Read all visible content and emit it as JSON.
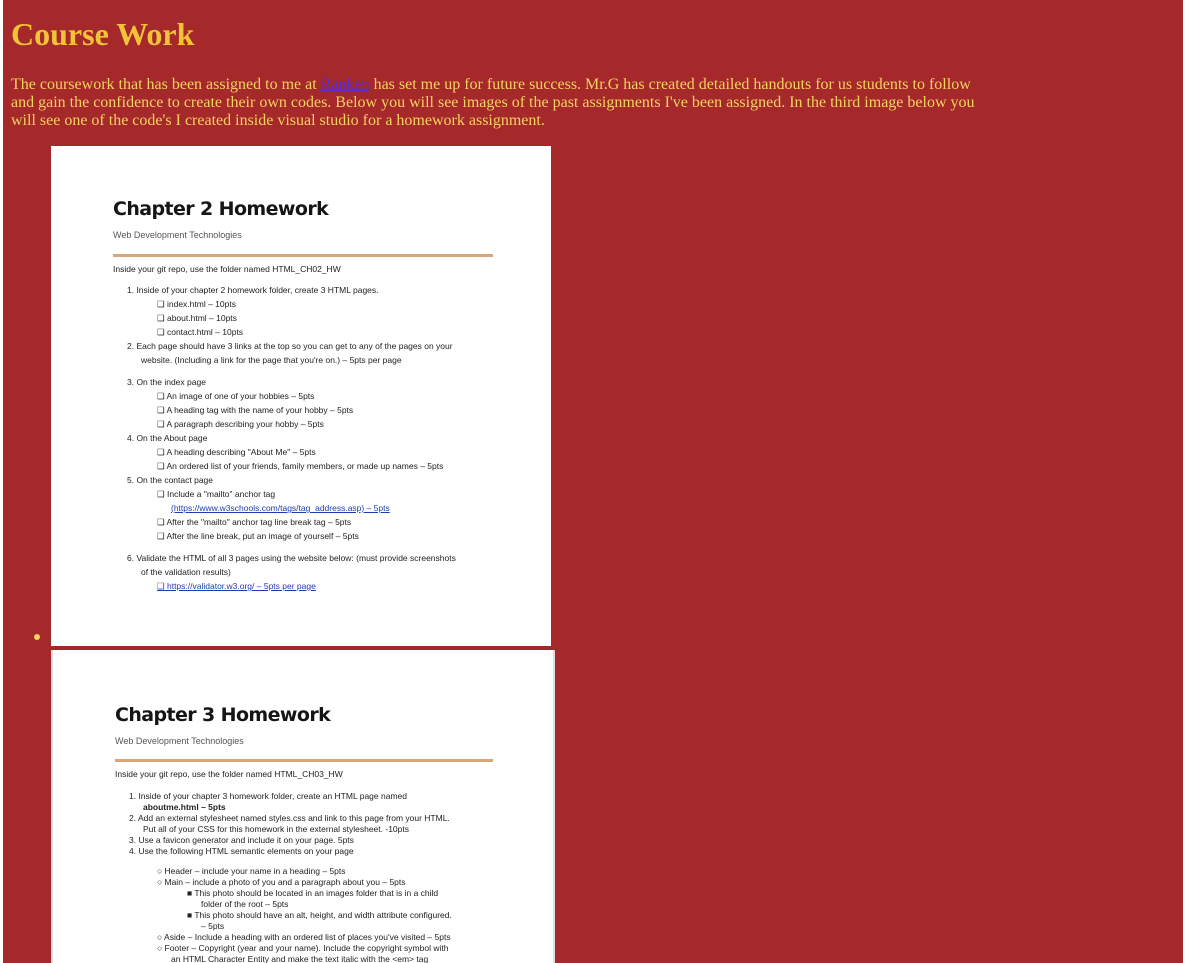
{
  "heading": "Course Work",
  "intro": {
    "before": "The coursework that has been assigned to me at ",
    "link": "Ranken",
    "after": " has set me up for future success. Mr.G has created detailed handouts for us students to follow and gain the confidence to create their own codes. Below you will see images of the past assignments I've been assigned. In the third image below you will see one of the code's I created inside visual studio for a homework assignment."
  },
  "colors": {
    "background": "#a5282a",
    "heading": "#f2c23a",
    "text": "#f4d35e",
    "link": "#5a2bd1"
  },
  "doc1": {
    "title": "Chapter 2 Homework",
    "subtitle": "Web Development Technologies",
    "lines": [
      "Inside your git repo, use the folder named HTML_CH02_HW",
      "1.   Inside of your chapter 2 homework folder, create 3 HTML pages.",
      "❑  index.html – 10pts",
      "❑  about.html – 10pts",
      "❑  contact.html – 10pts",
      "2.   Each page should have 3 links at the top so you can get to any of the pages on your",
      "website. (Including a link for the page that you're on.) – 5pts per page",
      "3.   On the index page",
      "❑  An image of one of your hobbies – 5pts",
      "❑  A heading tag with the name of your hobby – 5pts",
      "❑  A paragraph describing your hobby – 5pts",
      "4.   On the About page",
      "❑  A heading describing \"About Me\" – 5pts",
      "❑  An ordered list of your friends, family members, or made up names – 5pts",
      "5.    On the contact page",
      "❑  Include a \"mailto\" anchor tag",
      "(https://www.w3schools.com/tags/tag_address.asp) – 5pts",
      "❑  After the \"mailto\" anchor tag line break tag – 5pts",
      "❑  After the line break, put an image of yourself – 5pts",
      "6.   Validate the HTML of all 3 pages using the website below: (must provide screenshots",
      "of the validation results)",
      "❑  https://validator.w3.org/ – 5pts per page"
    ]
  },
  "doc2": {
    "title": "Chapter 3 Homework",
    "subtitle": "Web Development Technologies",
    "lines": [
      "Inside your git repo, use the folder named HTML_CH03_HW",
      "1.   Inside of your chapter 3 homework folder, create an HTML page named",
      "aboutme.html – 5pts",
      "2.   Add an external stylesheet named styles.css and link to this page from your HTML.",
      "Put all of your CSS for this homework in the external stylesheet. -10pts",
      "3.   Use a favicon generator and include it on your page. 5pts",
      "4.   Use the following HTML semantic elements on your page",
      "○   Header – include your name in a heading – 5pts",
      "○   Main – include a photo of you and a paragraph about you – 5pts",
      "■   This photo should be located in an images folder that is in a child",
      "folder of the root – 5pts",
      "■   This photo should have an alt, height, and width attribute configured.",
      "– 5pts",
      "○   Aside – Include a heading with an ordered list of places you've visited – 5pts",
      "○   Footer – Copyright (year and your name).  Include the copyright symbol with",
      "an HTML Character Entity and make the text italic with the <em> tag"
    ]
  }
}
